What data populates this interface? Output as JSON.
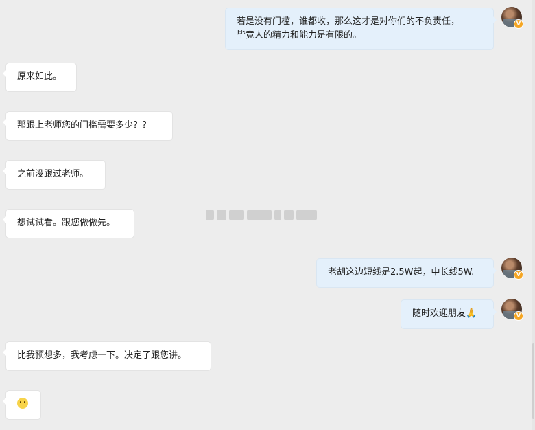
{
  "messages": [
    {
      "side": "out",
      "lines": [
        "若是没有门槛，谁都收，那么这才是对你们的不负责任，",
        "毕竟人的精力和能力是有限的。"
      ]
    },
    {
      "side": "in",
      "text": "原来如此。"
    },
    {
      "side": "in",
      "text": "那跟上老师您的门槛需要多少？？"
    },
    {
      "side": "in",
      "text": "之前没跟过老师。"
    },
    {
      "side": "in",
      "text": "想试试看。跟您做做先。"
    },
    {
      "side": "out",
      "text": "老胡这边短线是2.5W起，中长线5W."
    },
    {
      "side": "out",
      "text": "随时欢迎朋友",
      "emoji": "praying-hands"
    },
    {
      "side": "in",
      "text": "比我预想多，我考虑一下。决定了跟您讲。"
    },
    {
      "side": "in",
      "emoji": "smiley-face"
    }
  ],
  "avatar_badge": "V",
  "emoji_praying_hands": "🙏",
  "colors": {
    "background": "#ededed",
    "incoming_bubble": "#ffffff",
    "outgoing_bubble": "#e4f0fb",
    "badge": "#f5a623"
  }
}
